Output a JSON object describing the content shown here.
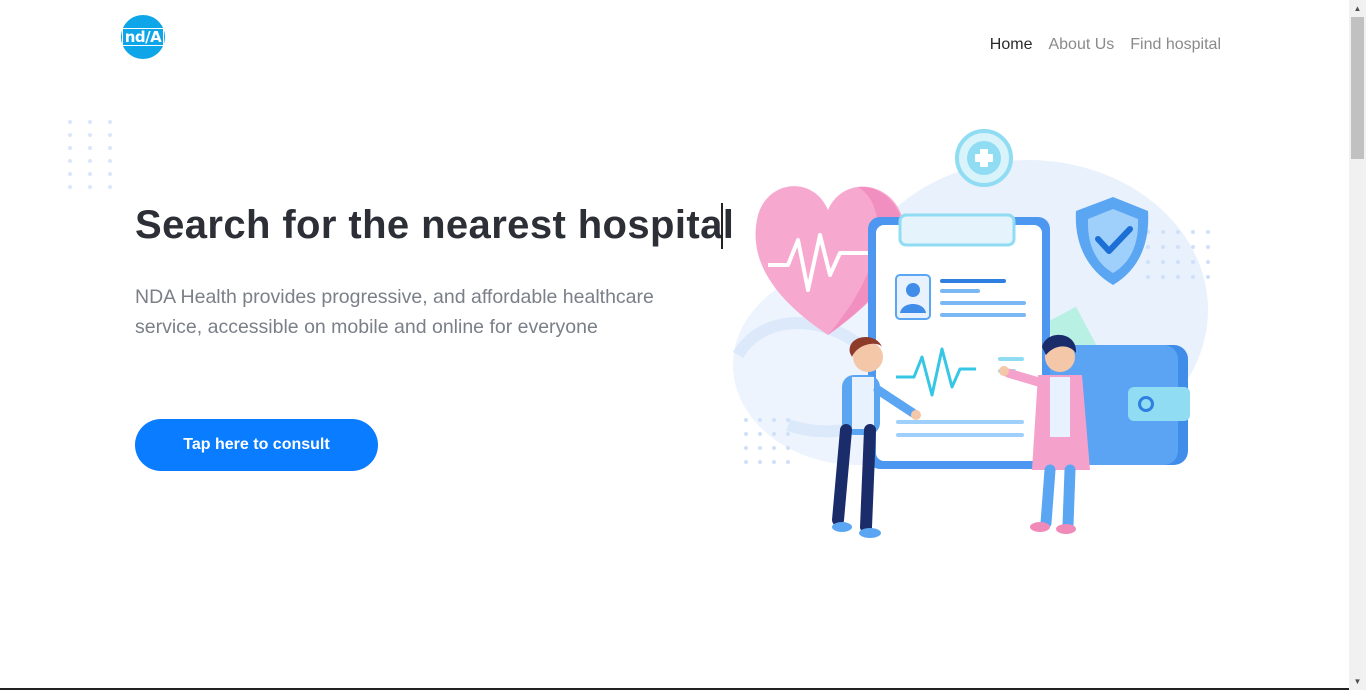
{
  "brand": {
    "logo_text": "nd/A"
  },
  "nav": {
    "items": [
      {
        "label": "Home",
        "active": true
      },
      {
        "label": "About Us",
        "active": false
      },
      {
        "label": "Find hospital",
        "active": false
      }
    ]
  },
  "hero": {
    "headline": "Search for the nearest hospital",
    "description": "NDA Health provides progressive, and affordable healthcare service, accessible on mobile and online for everyone",
    "cta_label": "Tap here to consult"
  },
  "colors": {
    "primary": "#0a7cff",
    "logo": "#0ea5e9",
    "heading": "#2c2f36",
    "body_text": "#7a7f88"
  },
  "illustration": {
    "icons": [
      "heart-icon",
      "plus-circle-icon",
      "shield-check-icon",
      "clipboard-icon",
      "wallet-icon"
    ]
  }
}
